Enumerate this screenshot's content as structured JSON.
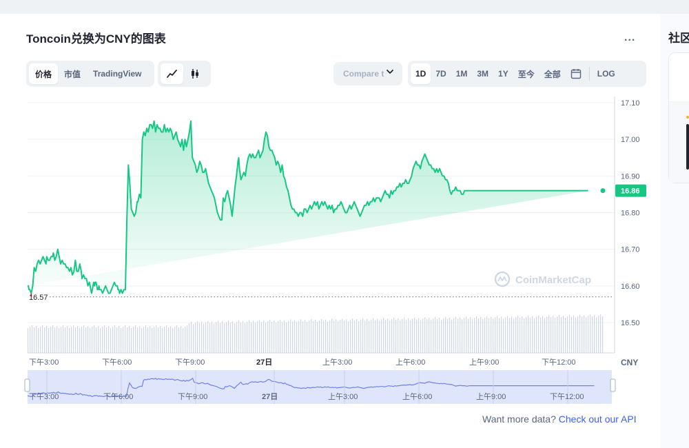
{
  "title": "Toncoin兑换为CNY的图表",
  "more_label": "...",
  "toggles": {
    "metric_tabs": [
      "价格",
      "市值",
      "TradingView"
    ],
    "active_metric": 0
  },
  "chart_type_icons": [
    "line-chart-icon",
    "candlestick-icon"
  ],
  "compare_label": "Compare t",
  "ranges": [
    "1D",
    "7D",
    "1M",
    "3M",
    "1Y",
    "至今",
    "全部"
  ],
  "active_range": "1D",
  "log_label": "LOG",
  "right_panel_title": "社区",
  "footer": {
    "prefix": "Want more data? ",
    "link": "Check out our API"
  },
  "watermark": "CoinMarketCap",
  "colors": {
    "line": "#16c784",
    "low_segment": "#ea3943",
    "brand": "#3861fb",
    "nav_line": "#6d82e7"
  },
  "chart_data": {
    "type": "area",
    "x_ticks": [
      "下午3:00",
      "下午6:00",
      "下午9:00",
      "27日",
      "上午3:00",
      "上午6:00",
      "上午9:00",
      "下午12:00"
    ],
    "y_ticks": [
      "17.10",
      "17.00",
      "16.90",
      "16.80",
      "16.70",
      "16.60",
      "16.50"
    ],
    "y_unit": "CNY",
    "ylim": [
      16.45,
      17.1
    ],
    "start_price_label": "16.57",
    "start_price": 16.57,
    "current_price_label": "16.86",
    "current_price": 16.86,
    "x_hours": [
      0,
      0.1,
      0.2,
      0.3,
      0.5,
      0.7,
      0.9,
      1.1,
      1.3,
      1.5,
      1.7,
      1.9,
      2.1,
      2.3,
      2.5,
      2.6,
      2.8,
      3.0,
      3.2,
      3.4,
      3.5,
      3.7,
      3.9,
      4.1,
      4.3,
      4.5,
      4.7,
      4.9,
      5.1,
      5.3,
      5.5,
      5.7,
      5.9,
      6.1,
      6.3,
      6.5,
      6.7,
      6.9,
      7.1,
      7.2,
      7.3,
      7.4,
      7.6,
      7.8,
      8.0,
      8.2,
      8.4,
      8.5,
      8.6,
      8.7,
      8.8,
      8.9,
      9.0,
      9.1,
      9.2,
      9.3,
      9.4,
      9.5,
      9.6,
      9.7,
      9.8,
      10.0,
      10.2,
      10.4,
      10.6,
      10.8,
      11.0,
      11.2,
      11.4,
      11.6,
      11.8,
      12.0,
      12.2,
      12.3,
      12.4,
      12.5,
      12.7,
      12.9,
      13.1,
      13.3,
      13.5,
      13.7,
      13.9,
      14.1,
      14.3,
      14.5,
      14.7,
      14.9,
      15.0,
      15.2,
      15.4,
      15.6,
      15.8,
      16.0,
      16.2,
      16.4,
      16.6,
      16.8,
      17.0,
      17.2,
      17.4,
      17.6,
      17.8,
      18.0,
      18.2,
      18.4,
      18.6,
      18.8,
      19.0,
      19.2,
      19.4,
      19.6,
      19.8,
      20.0,
      20.2,
      20.4,
      20.6,
      20.8,
      21.0,
      21.2,
      21.4,
      21.6,
      21.8,
      22.0,
      22.2,
      22.4,
      22.6,
      22.8,
      23.0,
      23.2,
      23.4,
      23.6,
      23.8,
      24.0,
      24.2,
      24.4,
      24.6,
      24.8,
      25.0,
      25.2,
      25.4,
      25.6,
      25.8,
      26.0,
      26.2,
      26.4,
      26.6,
      26.8,
      27.0,
      27.2,
      27.4,
      27.6,
      27.8,
      28.0,
      28.2,
      28.4,
      28.6,
      28.7,
      28.8,
      29.0,
      29.2,
      29.4,
      29.6,
      29.8,
      30.0,
      30.2,
      30.4,
      30.6,
      30.8,
      31.0,
      31.2,
      31.4,
      31.6,
      31.8,
      32.0,
      32.2,
      32.4,
      32.6,
      32.8,
      33.0,
      33.2,
      33.4,
      33.6,
      33.8,
      34.0,
      34.2,
      34.4,
      34.6,
      34.8,
      35.0,
      35.2,
      35.4,
      35.6,
      35.8,
      36.0,
      36.2,
      36.4,
      36.6,
      36.8,
      37.0,
      37.2,
      37.4,
      37.6,
      37.8,
      38.0,
      38.2,
      38.4,
      38.6,
      38.8,
      39.0,
      39.2,
      39.4,
      39.6,
      39.8,
      40.0,
      40.2,
      40.4,
      40.6,
      40.8,
      41.0,
      41.2,
      41.4,
      41.6,
      41.8,
      42.0,
      42.2,
      42.4,
      42.6,
      42.8,
      43.0,
      43.2,
      43.4,
      43.6,
      43.8,
      44.0,
      44.2,
      44.4,
      44.6,
      44.8,
      45.0,
      45.2,
      45.4,
      45.6,
      45.8,
      46.0,
      46.2,
      46.4,
      46.6,
      46.8,
      47.0,
      47.2,
      47.4,
      47.6,
      47.8,
      48.0,
      48.2,
      48.4,
      48.6,
      48.8,
      49.0,
      49.2,
      49.4,
      49.6,
      49.8,
      50.0,
      50.2,
      50.4,
      50.6,
      50.8,
      51.0,
      51.2,
      51.4,
      51.6,
      51.8,
      52.0,
      52.2,
      52.4,
      52.6,
      52.8,
      53.0,
      53.2,
      53.4,
      53.6,
      53.8,
      54.0,
      54.2,
      54.4,
      54.6,
      54.8,
      55.0,
      55.2,
      55.4,
      55.6,
      55.8,
      56.0,
      56.2,
      56.4,
      56.6,
      56.8,
      57.0,
      57.2,
      57.4,
      57.6,
      57.8,
      58.0,
      58.2,
      58.4,
      58.6,
      58.8,
      59.0,
      59.2,
      59.4,
      59.6,
      59.8,
      60.0,
      60.2,
      60.4,
      60.6,
      60.8,
      61.0,
      61.2,
      61.4,
      61.6,
      61.8,
      62.0,
      62.2,
      62.4,
      62.6,
      62.8,
      63.0,
      63.2,
      63.4,
      63.6,
      63.8,
      64.0,
      64.2,
      64.4,
      64.6,
      64.8,
      65.0,
      65.2,
      65.4,
      65.6,
      65.8,
      66.0,
      66.2,
      66.4,
      66.6,
      66.8,
      67.0,
      67.2,
      67.4,
      67.6,
      67.8,
      68.0,
      68.2,
      68.4,
      68.6,
      68.8,
      69.0,
      69.2,
      69.4,
      69.6,
      69.8,
      70.0,
      70.2,
      70.4,
      70.6,
      70.8,
      71.0,
      71.2,
      71.4,
      71.6,
      71.8,
      72.0,
      72.2,
      72.4,
      72.6,
      72.8,
      73.0,
      73.2,
      73.4,
      73.6,
      73.8,
      74.0,
      74.2,
      74.4,
      74.6,
      74.8,
      75.0,
      75.2,
      75.4,
      75.6,
      75.8,
      76.0,
      76.2,
      76.4,
      76.6,
      76.8,
      77.0,
      77.2,
      77.4,
      77.6,
      77.8,
      78.0,
      78.2
    ],
    "series": [
      {
        "values": [
          16.6,
          16.6,
          16.59,
          16.59,
          16.58,
          16.6,
          16.65,
          16.64,
          16.66,
          16.67,
          16.66,
          16.67,
          16.68,
          16.67,
          16.66,
          16.68,
          16.67,
          16.67,
          16.68,
          16.68,
          16.69,
          16.67,
          16.68,
          16.7,
          16.68,
          16.66,
          16.67,
          16.66,
          16.66,
          16.65,
          16.65,
          16.64,
          16.65,
          16.63,
          16.64,
          16.67,
          16.64,
          16.64,
          16.66,
          16.65,
          16.64,
          16.62,
          16.63,
          16.62,
          16.62,
          16.6,
          16.61,
          16.6,
          16.59,
          16.58,
          16.59,
          16.6,
          16.61,
          16.6,
          16.61,
          16.61,
          16.6,
          16.59,
          16.59,
          16.6,
          16.59,
          16.59,
          16.58,
          16.59,
          16.6,
          16.59,
          16.58,
          16.58,
          16.59,
          16.6,
          16.61,
          16.6,
          16.6,
          16.59,
          16.59,
          16.58,
          16.59,
          16.58,
          16.59,
          16.59,
          16.78,
          16.93,
          16.88,
          16.81,
          16.8,
          16.79,
          16.8,
          16.83,
          16.83,
          16.85,
          16.84,
          17.0,
          17.02,
          17.01,
          17.03,
          17.02,
          17.04,
          17.04,
          17.03,
          17.05,
          17.02,
          17.04,
          17.03,
          17.03,
          17.02,
          17.02,
          17.04,
          17.02,
          17.03,
          17.02,
          17.03,
          17.02,
          17.0,
          17.01,
          17.02,
          17.0,
          16.99,
          16.98,
          17.0,
          16.97,
          17.0,
          16.98,
          17.0,
          17.02,
          17.05,
          16.95,
          16.94,
          16.93,
          16.91,
          16.92,
          16.94,
          16.93,
          16.91,
          16.91,
          16.92,
          16.9,
          16.88,
          16.87,
          16.86,
          16.85,
          16.84,
          16.82,
          16.8,
          16.79,
          16.78,
          16.78,
          16.84,
          16.83,
          16.85,
          16.86,
          16.84,
          16.82,
          16.79,
          16.83,
          16.87,
          16.9,
          16.94,
          16.95,
          16.92,
          16.89,
          16.9,
          16.91,
          16.9,
          16.93,
          16.95,
          16.96,
          16.95,
          16.96,
          16.95,
          16.95,
          16.96,
          16.97,
          16.95,
          16.96,
          16.97,
          17.0,
          17.02,
          17.01,
          16.98,
          16.97,
          16.97,
          16.96,
          16.95,
          16.93,
          16.94,
          16.93,
          16.91,
          16.93,
          16.9,
          16.89,
          16.87,
          16.86,
          16.84,
          16.82,
          16.81,
          16.81,
          16.8,
          16.8,
          16.79,
          16.8,
          16.8,
          16.79,
          16.81,
          16.81,
          16.8,
          16.81,
          16.82,
          16.81,
          16.82,
          16.83,
          16.82,
          16.83,
          16.81,
          16.82,
          16.83,
          16.82,
          16.83,
          16.82,
          16.81,
          16.82,
          16.81,
          16.82,
          16.8,
          16.81,
          16.81,
          16.82,
          16.82,
          16.83,
          16.82,
          16.81,
          16.8,
          16.8,
          16.81,
          16.82,
          16.81,
          16.82,
          16.83,
          16.82,
          16.81,
          16.8,
          16.79,
          16.8,
          16.81,
          16.82,
          16.82,
          16.83,
          16.82,
          16.83,
          16.83,
          16.84,
          16.83,
          16.84,
          16.84,
          16.84,
          16.83,
          16.84,
          16.85,
          16.86,
          16.85,
          16.85,
          16.84,
          16.86,
          16.85,
          16.86,
          16.86,
          16.87,
          16.87,
          16.88,
          16.87,
          16.88,
          16.88,
          16.89,
          16.88,
          16.88,
          16.89,
          16.9,
          16.92,
          16.93,
          16.94,
          16.93,
          16.93,
          16.92,
          16.94,
          16.95,
          16.96,
          16.95,
          16.94,
          16.93,
          16.93,
          16.92,
          16.92,
          16.91,
          16.92,
          16.91,
          16.92,
          16.91,
          16.9,
          16.9,
          16.89,
          16.89,
          16.88,
          16.86,
          16.85,
          16.86,
          16.86,
          16.87,
          16.86,
          16.86,
          16.86,
          16.85,
          16.85,
          16.86,
          16.86,
          16.86,
          16.86,
          16.86,
          16.86,
          16.86,
          16.86,
          16.86,
          16.86,
          16.86,
          16.86,
          16.86,
          16.86,
          16.86,
          16.86,
          16.86,
          16.86,
          16.86,
          16.86,
          16.86,
          16.86,
          16.86,
          16.86,
          16.86,
          16.86,
          16.86,
          16.86,
          16.86,
          16.86,
          16.86,
          16.86,
          16.86,
          16.86,
          16.86,
          16.86,
          16.86,
          16.86,
          16.86,
          16.86,
          16.86,
          16.86,
          16.86,
          16.86,
          16.86,
          16.86,
          16.86,
          16.86,
          16.86,
          16.86,
          16.86,
          16.86,
          16.86,
          16.86,
          16.86,
          16.86,
          16.86,
          16.86,
          16.86,
          16.86,
          16.86,
          16.86,
          16.86,
          16.86,
          16.86,
          16.86,
          16.86,
          16.86,
          16.86,
          16.86,
          16.86,
          16.86,
          16.86,
          16.86,
          16.86,
          16.86,
          16.86,
          16.86,
          16.86,
          16.86,
          16.86,
          16.86,
          16.86,
          16.86,
          16.86
        ]
      }
    ]
  }
}
